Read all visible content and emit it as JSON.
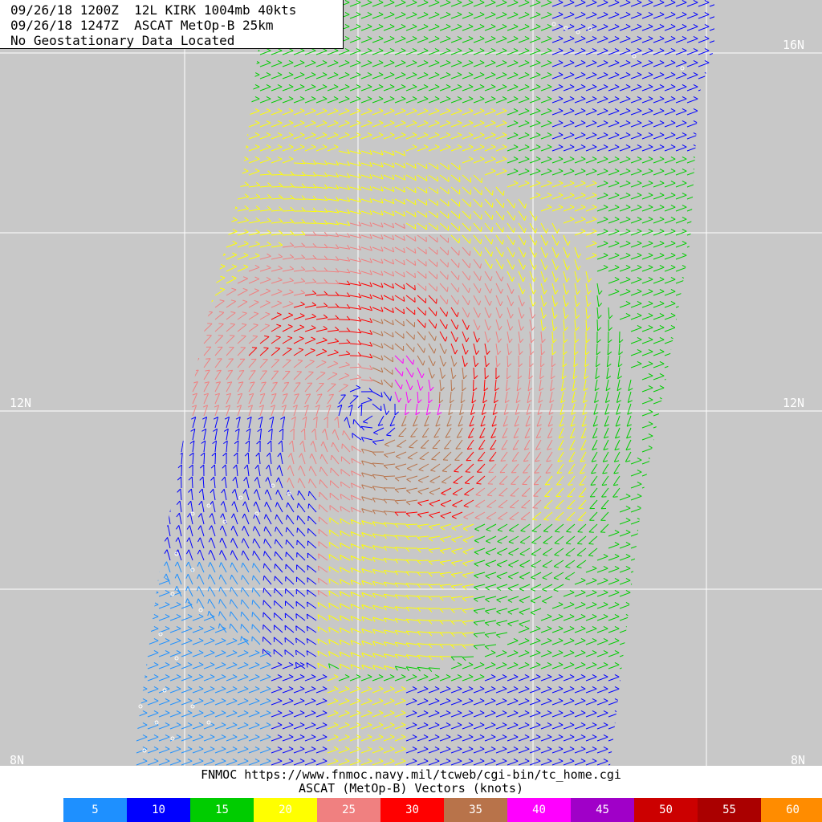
{
  "header": {
    "line1": "09/26/18 1200Z  12L KIRK 1004mb 40kts",
    "line2": "09/26/18 1247Z  ASCAT MetOp-B 25km",
    "line3": "No Geostationary Data Located"
  },
  "latitude_labels": {
    "n16": "16N",
    "n12": "12N",
    "n8": "8N"
  },
  "footer": {
    "credit": "FNMOC https://www.fnmoc.navy.mil/tcweb/cgi-bin/tc_home.cgi",
    "legend_title": "ASCAT (MetOp-B) Vectors (knots)"
  },
  "legend": [
    {
      "label": "5",
      "color": "#1e90ff"
    },
    {
      "label": "10",
      "color": "#0000ff"
    },
    {
      "label": "15",
      "color": "#00cc00"
    },
    {
      "label": "20",
      "color": "#ffff00"
    },
    {
      "label": "25",
      "color": "#f08080"
    },
    {
      "label": "30",
      "color": "#ff0000"
    },
    {
      "label": "35",
      "color": "#b8734a"
    },
    {
      "label": "40",
      "color": "#ff00ff"
    },
    {
      "label": "45",
      "color": "#a000c8"
    },
    {
      "label": "50",
      "color": "#cc0000"
    },
    {
      "label": "55",
      "color": "#aa0000"
    },
    {
      "label": "60",
      "color": "#ff8c00"
    }
  ],
  "storm": {
    "name": "KIRK",
    "id": "12L",
    "pressure_mb": 1004,
    "intensity_kts": 40
  },
  "map_style": {
    "background": "#c8c8c8",
    "gridline": "#ffffff"
  }
}
